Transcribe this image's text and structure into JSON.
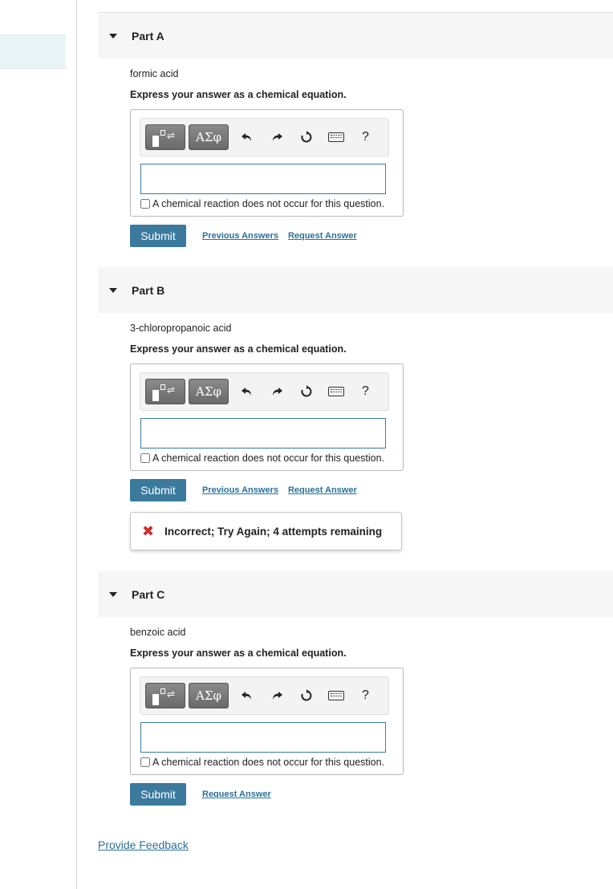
{
  "parts": [
    {
      "title": "Part A",
      "prompt": "formic acid",
      "instruction": "Express your answer as a chemical equation.",
      "greek_label": "ΑΣφ",
      "input_value": "",
      "no_reaction_label": "A chemical reaction does not occur for this question.",
      "submit_label": "Submit",
      "previous_answers_label": "Previous Answers",
      "request_answer_label": "Request Answer"
    },
    {
      "title": "Part B",
      "prompt": "3-chloropropanoic acid",
      "instruction": "Express your answer as a chemical equation.",
      "greek_label": "ΑΣφ",
      "input_value": "",
      "no_reaction_label": "A chemical reaction does not occur for this question.",
      "submit_label": "Submit",
      "previous_answers_label": "Previous Answers",
      "request_answer_label": "Request Answer",
      "feedback": "Incorrect; Try Again; 4 attempts remaining"
    },
    {
      "title": "Part C",
      "prompt": "benzoic acid",
      "instruction": "Express your answer as a chemical equation.",
      "greek_label": "ΑΣφ",
      "input_value": "",
      "no_reaction_label": "A chemical reaction does not occur for this question.",
      "submit_label": "Submit",
      "request_answer_label": "Request Answer"
    }
  ],
  "toolbar": {
    "help_label": "?",
    "icons": [
      "template-icon",
      "greek-letters-icon",
      "undo-icon",
      "redo-icon",
      "reset-icon",
      "keyboard-icon",
      "help-icon"
    ]
  },
  "feedback_icon": "x-icon",
  "footer": {
    "provide_feedback_label": "Provide Feedback"
  },
  "colors": {
    "submit": "#3b7a9d",
    "link": "#2a7199",
    "error": "#d0292a",
    "header_bg": "#f6f6f6",
    "sidebar_highlight": "#e9f4f7"
  }
}
